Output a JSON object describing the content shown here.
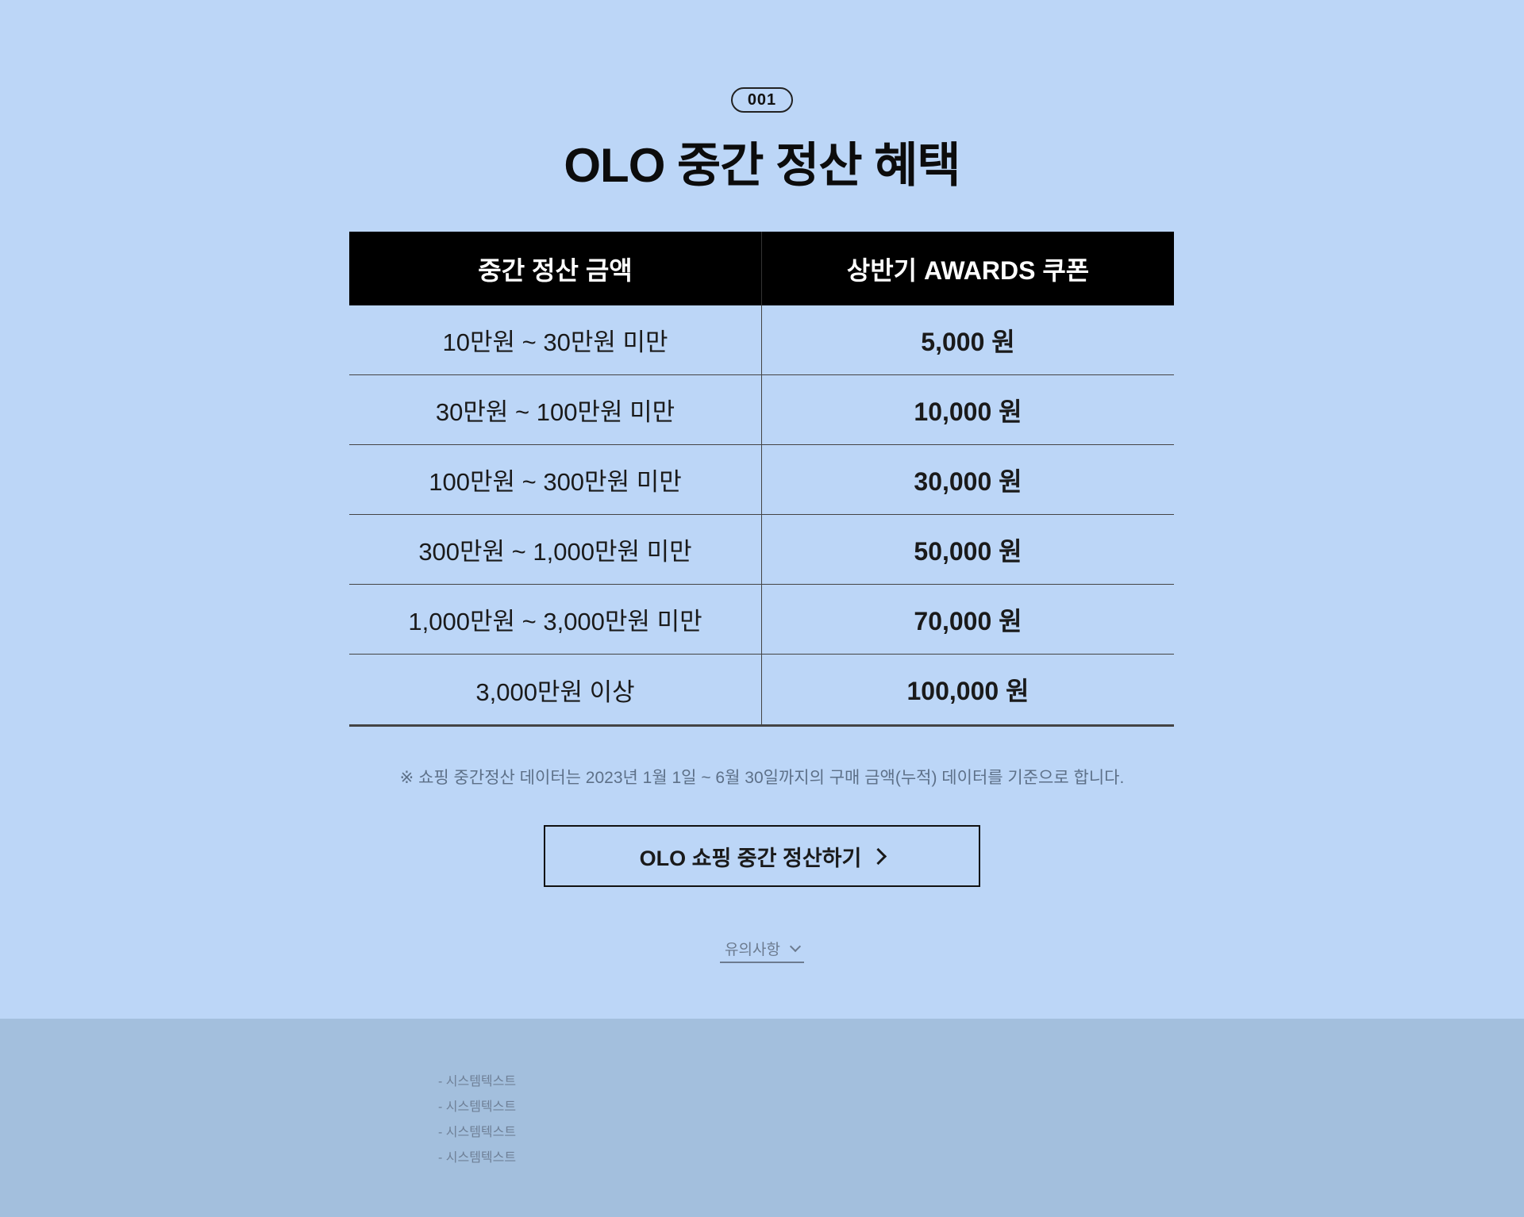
{
  "badge": "001",
  "title": "OLO 중간 정산 혜택",
  "table": {
    "headers": [
      "중간 정산 금액",
      "상반기 AWARDS 쿠폰"
    ],
    "rows": [
      {
        "range": "10만원 ~ 30만원 미만",
        "coupon": "5,000 원"
      },
      {
        "range": "30만원 ~ 100만원 미만",
        "coupon": "10,000 원"
      },
      {
        "range": "100만원 ~ 300만원 미만",
        "coupon": "30,000 원"
      },
      {
        "range": "300만원 ~ 1,000만원 미만",
        "coupon": "50,000 원"
      },
      {
        "range": "1,000만원 ~ 3,000만원 미만",
        "coupon": "70,000 원"
      },
      {
        "range": "3,000만원 이상",
        "coupon": "100,000 원"
      }
    ]
  },
  "note": "※ 쇼핑 중간정산 데이터는 2023년 1월 1일 ~ 6월 30일까지의 구매 금액(누적) 데이터를 기준으로 합니다.",
  "cta": {
    "label": "OLO 쇼핑 중간 정산하기"
  },
  "notice": {
    "label": "유의사항"
  },
  "system_texts": [
    "- 시스템텍스트",
    "- 시스템텍스트",
    "- 시스템텍스트",
    "- 시스템텍스트"
  ],
  "colors": {
    "background": "#bcd6f7",
    "footer": "#a3bfdd",
    "header_row": "#000000"
  }
}
